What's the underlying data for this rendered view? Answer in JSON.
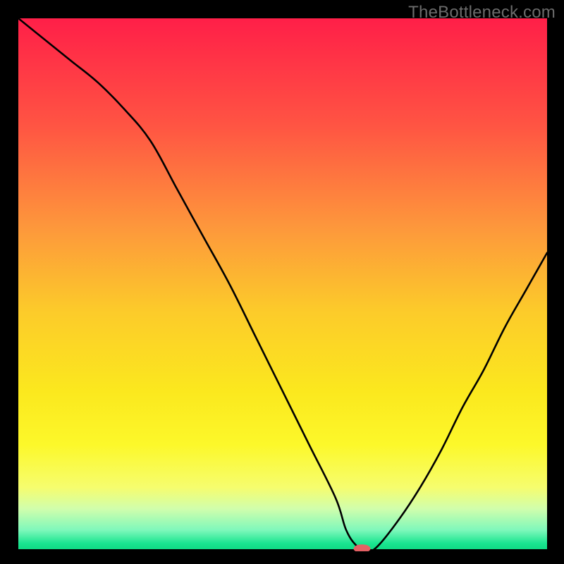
{
  "watermark": "TheBottleneck.com",
  "chart_data": {
    "type": "line",
    "title": "",
    "xlabel": "",
    "ylabel": "",
    "xlim": [
      0,
      100
    ],
    "ylim": [
      0,
      100
    ],
    "background": {
      "type": "vertical-gradient",
      "stops": [
        {
          "offset": 0.0,
          "color": "#ff1f48"
        },
        {
          "offset": 0.2,
          "color": "#ff5443"
        },
        {
          "offset": 0.4,
          "color": "#fd9a3b"
        },
        {
          "offset": 0.55,
          "color": "#fccb2a"
        },
        {
          "offset": 0.7,
          "color": "#fbe81e"
        },
        {
          "offset": 0.8,
          "color": "#fcf82a"
        },
        {
          "offset": 0.88,
          "color": "#f6fd6e"
        },
        {
          "offset": 0.92,
          "color": "#d1feac"
        },
        {
          "offset": 0.96,
          "color": "#7ff8bb"
        },
        {
          "offset": 0.985,
          "color": "#1ae590"
        },
        {
          "offset": 1.0,
          "color": "#0dd780"
        }
      ]
    },
    "series": [
      {
        "name": "bottleneck-curve",
        "color": "#000000",
        "x": [
          0,
          5,
          10,
          15,
          20,
          25,
          30,
          35,
          40,
          45,
          50,
          55,
          60,
          62,
          64,
          66,
          68,
          72,
          76,
          80,
          84,
          88,
          92,
          96,
          100
        ],
        "y": [
          100,
          96,
          92,
          88,
          83,
          77,
          68,
          59,
          50,
          40,
          30,
          20,
          10,
          4,
          1,
          0,
          1,
          6,
          12,
          19,
          27,
          34,
          42,
          49,
          56
        ]
      }
    ],
    "marker": {
      "name": "optimal-point",
      "x": 65,
      "y": 0.5,
      "color": "#e46064",
      "rx": 12,
      "ry": 6
    },
    "baseline": {
      "y": 0,
      "color": "#000000"
    }
  },
  "colors": {
    "frame": "#000000",
    "watermark": "#6b6b6b"
  }
}
